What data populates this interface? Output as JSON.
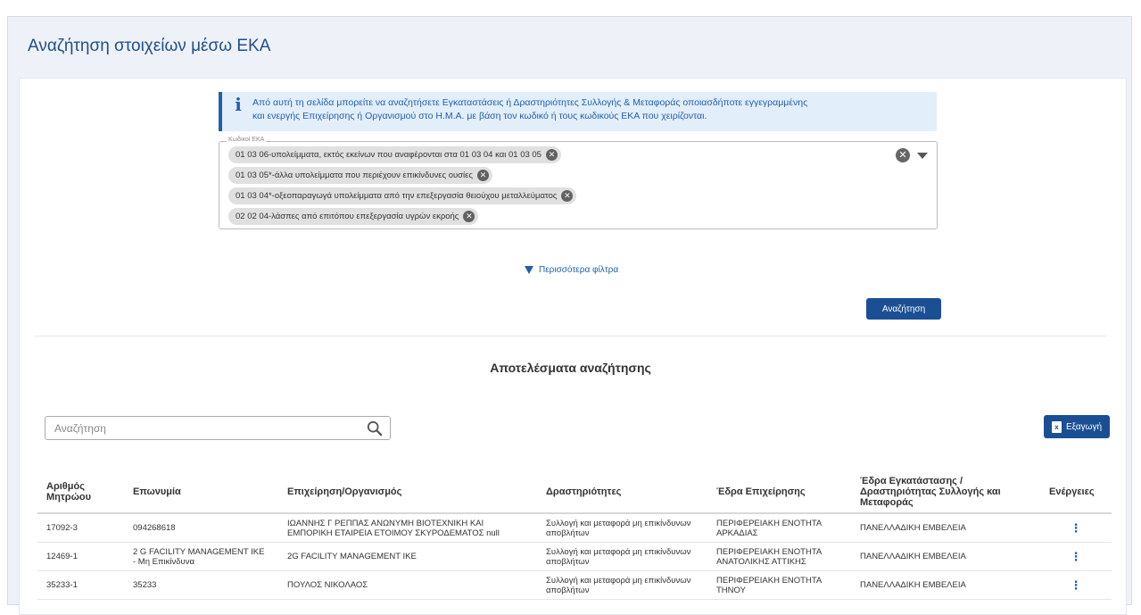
{
  "page": {
    "title": "Αναζήτηση στοιχείων μέσω ΕΚΑ"
  },
  "info": {
    "icon": "info-icon",
    "line1": "Από αυτή τη σελίδα μπορείτε να αναζητήσετε Εγκαταστάσεις ή Δραστηριότητες Συλλογής & Μεταφοράς οποιασδήποτε εγγεγραμμένης",
    "line2": "και ενεργής Επιχείρησης ή Οργανισμού στο Η.Μ.Α. με βάση τον κωδικό ή τους κωδικούς ΕΚΑ που χειρίζονται."
  },
  "filter": {
    "legend": "Κωδικοί ΕΚΑ",
    "chips": [
      "01 03 06-υπολείμματα, εκτός εκείνων που αναφέρονται στα 01 03 04 και 01 03 05",
      "01 03 05*-άλλα υπολείμματα που περιέχουν επικίνδυνες ουσίες",
      "01 03 04*-οξεοπαραγωγά υπολείμματα από την επεξεργασία θειούχου μεταλλεύματος",
      "02 02 04-λάσπες από επιτόπου επεξεργασία υγρών εκροής"
    ],
    "more_filters": "Περισσότερα φίλτρα",
    "search_button": "Αναζήτηση"
  },
  "results": {
    "title": "Αποτελέσματα αναζήτησης",
    "search_placeholder": "Αναζήτηση",
    "export_button": "Εξαγωγή",
    "columns": [
      "Αριθμός Μητρώου",
      "Επωνυμία",
      "Επιχείρηση/Οργανισμός",
      "Δραστηριότητες",
      "Έδρα Επιχείρησης",
      "Έδρα Εγκατάστασης / Δραστηριότητας Συλλογής και Μεταφοράς",
      "Ενέργειες"
    ],
    "rows": [
      {
        "registry": "17092-3",
        "name": "094268618",
        "org": "ΙΩΑΝΝΗΣ Γ ΡΕΠΠΑΣ ΑΝΩΝΥΜΗ ΒΙΟΤΕΧΝΙΚΗ ΚΑΙ ΕΜΠΟΡΙΚΗ ΕΤΑΙΡΕΙΑ ΕΤΟΙΜΟΥ ΣΚΥΡΟΔΕΜΑΤΟΣ null",
        "activities": "Συλλογή και μεταφορά μη επικίνδυνων αποβλήτων",
        "hq": "ΠΕΡΙΦΕΡΕΙΑΚΗ ΕΝΟΤΗΤΑ ΑΡΚΑΔΙΑΣ",
        "facility": "ΠΑΝΕΛΛΑΔΙΚΗ ΕΜΒΕΛΕΙΑ"
      },
      {
        "registry": "12469-1",
        "name": "2 G FACILITY MANAGEMENT IKE - Μη Επικίνδυνα",
        "org": "2G FACILITY MANAGEMENT IKE",
        "activities": "Συλλογή και μεταφορά μη επικίνδυνων αποβλήτων",
        "hq": "ΠΕΡΙΦΕΡΕΙΑΚΗ ΕΝΟΤΗΤΑ ΑΝΑΤΟΛΙΚΗΣ ΑΤΤΙΚΗΣ",
        "facility": "ΠΑΝΕΛΛΑΔΙΚΗ ΕΜΒΕΛΕΙΑ"
      },
      {
        "registry": "35233-1",
        "name": "35233",
        "org": "ΠΟΥΛΟΣ ΝΙΚΟΛΑΟΣ",
        "activities": "Συλλογή και μεταφορά μη επικίνδυνων αποβλήτων",
        "hq": "ΠΕΡΙΦΕΡΕΙΑΚΗ ΕΝΟΤΗΤΑ ΤΗΝΟΥ",
        "facility": "ΠΑΝΕΛΛΑΔΙΚΗ ΕΜΒΕΛΕΙΑ"
      }
    ]
  }
}
